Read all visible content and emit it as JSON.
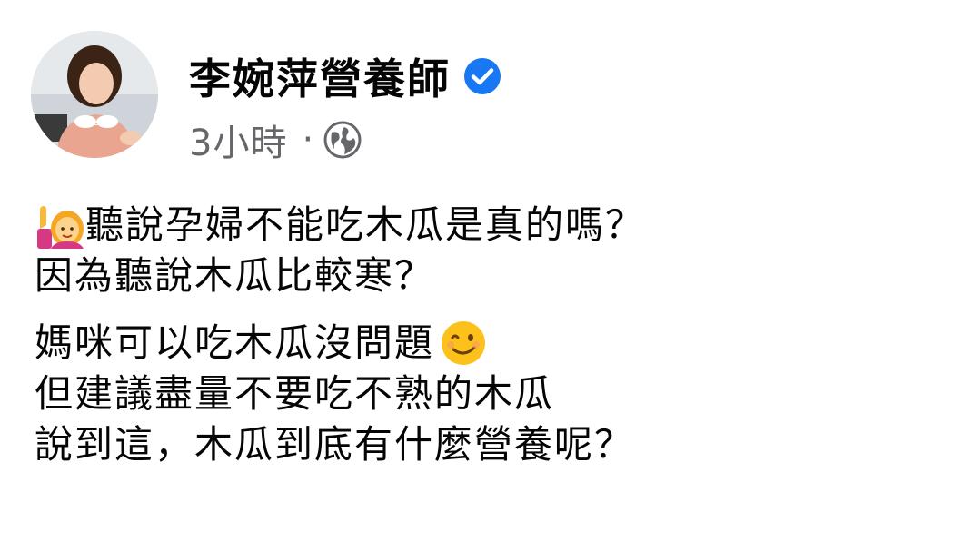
{
  "post": {
    "author": {
      "name": "李婉萍營養師",
      "verified_icon": "verified-badge-icon",
      "avatar": "profile-photo"
    },
    "meta": {
      "timestamp": "3小時",
      "separator": "·",
      "audience_icon": "globe-icon"
    },
    "body": {
      "line1": "聽說孕婦不能吃木瓜是真的嗎？",
      "line1_emoji": "woman-raising-hand-emoji",
      "line2": "因為聽說木瓜比較寒？",
      "line3": "媽咪可以吃木瓜沒問題",
      "line3_emoji": "winking-face-emoji",
      "line4": "但建議盡量不要吃不熟的木瓜",
      "line5": "說到這，木瓜到底有什麼營養呢？"
    }
  },
  "colors": {
    "text": "#050505",
    "secondary": "#65676b",
    "verified": "#1877f2"
  }
}
